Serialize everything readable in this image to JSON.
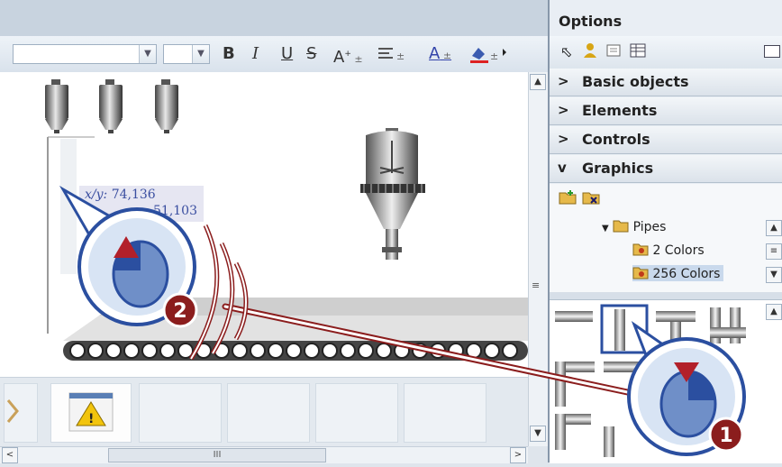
{
  "toolbar": {
    "bold": "B",
    "italic": "I",
    "underline": "U",
    "strike": "S",
    "font_grow": "A",
    "font_color": "A"
  },
  "canvas": {
    "tooltip_xy_label": "x/y:",
    "tooltip_xy_value": "74,136",
    "tooltip_wh_value": "51,103"
  },
  "callouts": {
    "step1": "1",
    "step2": "2"
  },
  "options": {
    "title": "Options",
    "sections": [
      {
        "chevron": ">",
        "label": "Basic objects"
      },
      {
        "chevron": ">",
        "label": "Elements"
      },
      {
        "chevron": ">",
        "label": "Controls"
      },
      {
        "chevron": "v",
        "label": "Graphics"
      }
    ],
    "tree": {
      "folder": "Pipes",
      "children": [
        "2 Colors",
        "256 Colors"
      ]
    }
  },
  "hscroll": {
    "thumb_label": "III"
  },
  "colors": {
    "accent_blue": "#2b4fa0",
    "callout_red": "#8b1d1d",
    "selection": "#c9d9ec"
  }
}
